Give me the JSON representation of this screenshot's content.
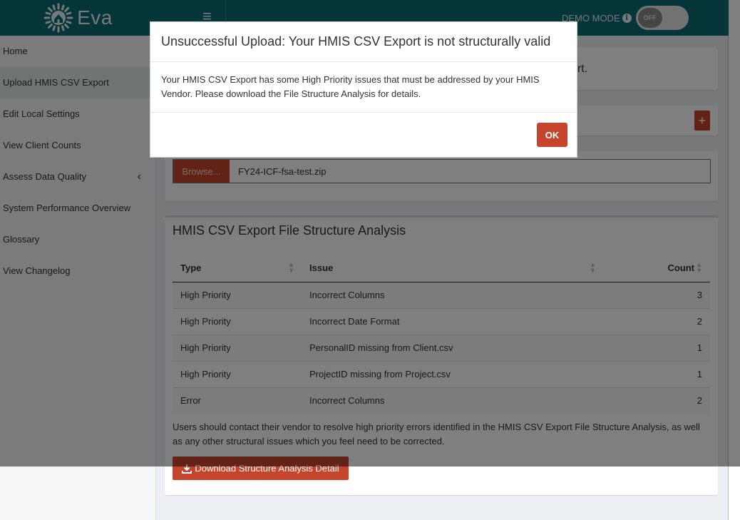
{
  "header": {
    "logo_text": "Eva",
    "menu_glyph": "≡",
    "demo_mode_label": "DEMO MODE",
    "toggle_state": "OFF"
  },
  "sidebar": {
    "items": [
      {
        "label": "Home"
      },
      {
        "label": "Upload HMIS CSV Export",
        "active": true
      },
      {
        "label": "Edit Local Settings"
      },
      {
        "label": "View Client Counts"
      },
      {
        "label": "Assess Data Quality",
        "has_submenu": true
      },
      {
        "label": "System Performance Overview"
      },
      {
        "label": "Glossary"
      },
      {
        "label": "View Changelog"
      }
    ]
  },
  "main": {
    "intro_text_fragment": "ort.",
    "upload": {
      "browse_label": "Browse...",
      "file_name": "FY24-ICF-fsa-test.zip"
    },
    "analysis": {
      "title": "HMIS CSV Export File Structure Analysis",
      "columns": [
        "Type",
        "Issue",
        "Count"
      ],
      "rows": [
        {
          "type": "High Priority",
          "issue": "Incorrect Columns",
          "count": "3"
        },
        {
          "type": "High Priority",
          "issue": "Incorrect Date Format",
          "count": "2"
        },
        {
          "type": "High Priority",
          "issue": "PersonalID missing from Client.csv",
          "count": "1"
        },
        {
          "type": "High Priority",
          "issue": "ProjectID missing from Project.csv",
          "count": "1"
        },
        {
          "type": "Error",
          "issue": "Incorrect Columns",
          "count": "2"
        }
      ],
      "note": "Users should contact their vendor to resolve high priority errors identified in the HMIS CSV Export File Structure Analysis, as well as any other structural issues which you feel need to be corrected.",
      "download_label": "Download Structure Analysis Detail"
    }
  },
  "modal": {
    "title": "Unsuccessful Upload: Your HMIS CSV Export is not structurally valid",
    "body": "Your HMIS CSV Export has some High Priority issues that must be addressed by your HMIS Vendor. Please download the File Structure Analysis for details.",
    "ok_label": "OK"
  },
  "colors": {
    "header_bg": "#0b6b73",
    "accent": "#c4452b",
    "sidebar_bg": "#f7f7f7",
    "content_bg": "#ecf0f5"
  }
}
